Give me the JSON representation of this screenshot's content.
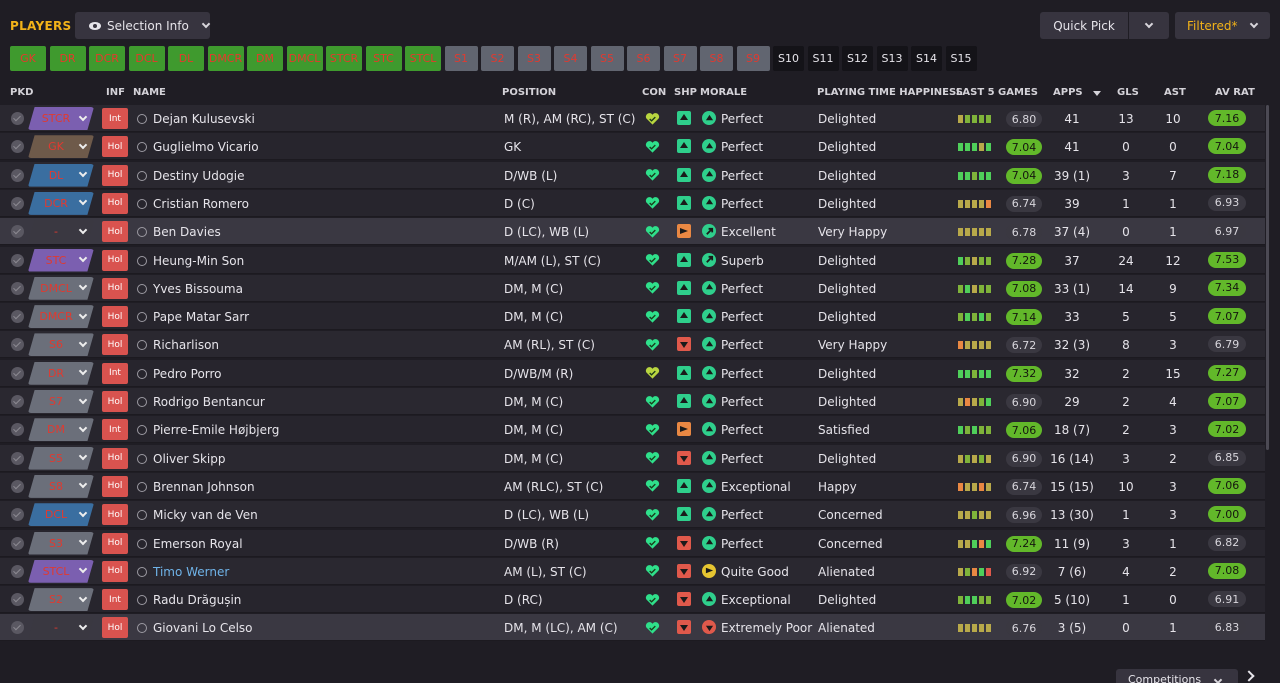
{
  "header": {
    "title": "PLAYERS",
    "selection_info": "Selection Info",
    "quick_pick": "Quick Pick",
    "filtered": "Filtered*"
  },
  "tags": [
    {
      "label": "GK",
      "style": "green"
    },
    {
      "label": "DR",
      "style": "green"
    },
    {
      "label": "DCR",
      "style": "green"
    },
    {
      "label": "DCL",
      "style": "green"
    },
    {
      "label": "DL",
      "style": "green"
    },
    {
      "label": "DMCR",
      "style": "green"
    },
    {
      "label": "DM",
      "style": "green"
    },
    {
      "label": "DMCL",
      "style": "green"
    },
    {
      "label": "STCR",
      "style": "green"
    },
    {
      "label": "STC",
      "style": "green"
    },
    {
      "label": "STCL",
      "style": "green"
    },
    {
      "label": "S1",
      "style": "grey"
    },
    {
      "label": "S2",
      "style": "grey"
    },
    {
      "label": "S3",
      "style": "grey"
    },
    {
      "label": "S4",
      "style": "grey"
    },
    {
      "label": "S5",
      "style": "grey"
    },
    {
      "label": "S6",
      "style": "grey"
    },
    {
      "label": "S7",
      "style": "grey"
    },
    {
      "label": "S8",
      "style": "grey"
    },
    {
      "label": "S9",
      "style": "grey"
    },
    {
      "label": "S10",
      "style": "dark"
    },
    {
      "label": "S11",
      "style": "dark"
    },
    {
      "label": "S12",
      "style": "dark"
    },
    {
      "label": "S13",
      "style": "dark"
    },
    {
      "label": "S14",
      "style": "dark"
    },
    {
      "label": "S15",
      "style": "dark"
    }
  ],
  "columns": {
    "pkd": "PKD",
    "inf": "INF",
    "name": "NAME",
    "position": "POSITION",
    "con": "CON",
    "shp": "SHP",
    "morale": "MORALE",
    "pth": "PLAYING TIME HAPPINESS",
    "last5": "LAST 5 GAMES",
    "apps": "APPS",
    "gls": "GLS",
    "ast": "AST",
    "avrat": "AV RAT"
  },
  "colors": {
    "accent": "#f3b319",
    "green_rating": "#62b82a",
    "status_up": "#2fcf8c",
    "status_down": "#e0594b",
    "status_mid": "#e98843",
    "position_text": "#e03a30"
  },
  "players": [
    {
      "pick": "STCR",
      "pick_color": "#7b5fb0",
      "inf": "Int",
      "name": "Dejan Kulusevski",
      "position": "M (R), AM (RC), ST (C)",
      "con": "good",
      "shp": "up",
      "morale": "Perfect",
      "morale_icon": "green-up",
      "pth": "Delighted",
      "last5": [
        "#b8a94a",
        "#7fb33a",
        "#7fb33a",
        "#7fb33a",
        "#7fb33a"
      ],
      "last5_avg": "6.80",
      "last5_style": "dk",
      "apps": "41",
      "gls": "13",
      "ast": "10",
      "avrat": "7.16",
      "avrat_style": "gr"
    },
    {
      "pick": "GK",
      "pick_color": "#6e5a4a",
      "inf": "Hol",
      "name": "Guglielmo Vicario",
      "position": "GK",
      "con": "full",
      "shp": "up",
      "morale": "Perfect",
      "morale_icon": "green-up",
      "pth": "Delighted",
      "last5": [
        "#4fcf5a",
        "#4fcf5a",
        "#4fcf5a",
        "#b8a94a",
        "#4fcf5a"
      ],
      "last5_avg": "7.04",
      "last5_style": "gr",
      "apps": "41",
      "gls": "0",
      "ast": "0",
      "avrat": "7.04",
      "avrat_style": "gr"
    },
    {
      "pick": "DL",
      "pick_color": "#3a6ea0",
      "inf": "Hol",
      "name": "Destiny Udogie",
      "position": "D/WB (L)",
      "con": "full",
      "shp": "up",
      "morale": "Perfect",
      "morale_icon": "green-up",
      "pth": "Delighted",
      "last5": [
        "#4fcf5a",
        "#4fcf5a",
        "#7fb33a",
        "#4fcf5a",
        "#4fcf5a"
      ],
      "last5_avg": "7.04",
      "last5_style": "gr",
      "apps": "39 (1)",
      "gls": "3",
      "ast": "7",
      "avrat": "7.18",
      "avrat_style": "gr"
    },
    {
      "pick": "DCR",
      "pick_color": "#3a6ea0",
      "inf": "Hol",
      "name": "Cristian Romero",
      "position": "D (C)",
      "con": "full",
      "shp": "up",
      "morale": "Perfect",
      "morale_icon": "green-up",
      "pth": "Delighted",
      "last5": [
        "#b8a94a",
        "#b8a94a",
        "#b8a94a",
        "#b8a94a",
        "#e98843"
      ],
      "last5_avg": "6.74",
      "last5_style": "dk",
      "apps": "39",
      "gls": "1",
      "ast": "1",
      "avrat": "6.93",
      "avrat_style": "dk"
    },
    {
      "pick": "-",
      "pick_color": "#3a3841",
      "inf": "Hol",
      "name": "Ben Davies",
      "position": "D (LC), WB (L)",
      "con": "full",
      "shp": "md",
      "morale": "Excellent",
      "morale_icon": "green-right",
      "pth": "Very Happy",
      "last5": [
        "#b8a94a",
        "#b8a94a",
        "#b8a94a",
        "#b8a94a",
        "#b8a94a"
      ],
      "last5_avg": "6.78",
      "last5_style": "dk",
      "apps": "37 (4)",
      "gls": "0",
      "ast": "1",
      "avrat": "6.97",
      "avrat_style": "dk"
    },
    {
      "pick": "STC",
      "pick_color": "#7b5fb0",
      "inf": "Hol",
      "name": "Heung-Min Son",
      "position": "M/AM (L), ST (C)",
      "con": "full",
      "shp": "up",
      "morale": "Superb",
      "morale_icon": "green-right",
      "pth": "Delighted",
      "last5": [
        "#4fcf5a",
        "#7fb33a",
        "#b8a94a",
        "#7fb33a",
        "#7fb33a"
      ],
      "last5_avg": "7.28",
      "last5_style": "gr",
      "apps": "37",
      "gls": "24",
      "ast": "12",
      "avrat": "7.53",
      "avrat_style": "gr"
    },
    {
      "pick": "DMCL",
      "pick_color": "#6b6f7a",
      "inf": "Hol",
      "name": "Yves Bissouma",
      "position": "DM, M (C)",
      "con": "full",
      "shp": "up",
      "morale": "Perfect",
      "morale_icon": "green-up",
      "pth": "Delighted",
      "last5": [
        "#7fb33a",
        "#4fcf5a",
        "#b8a94a",
        "#7fb33a",
        "#7fb33a"
      ],
      "last5_avg": "7.08",
      "last5_style": "gr",
      "apps": "33 (1)",
      "gls": "14",
      "ast": "9",
      "avrat": "7.34",
      "avrat_style": "gr"
    },
    {
      "pick": "DMCR",
      "pick_color": "#6b6f7a",
      "inf": "Hol",
      "name": "Pape Matar Sarr",
      "position": "DM, M (C)",
      "con": "full",
      "shp": "up",
      "morale": "Perfect",
      "morale_icon": "green-up",
      "pth": "Delighted",
      "last5": [
        "#7fb33a",
        "#4fcf5a",
        "#7fb33a",
        "#4fcf5a",
        "#7fb33a"
      ],
      "last5_avg": "7.14",
      "last5_style": "gr",
      "apps": "33",
      "gls": "5",
      "ast": "5",
      "avrat": "7.07",
      "avrat_style": "gr"
    },
    {
      "pick": "S6",
      "pick_color": "#6b6f7a",
      "inf": "Hol",
      "name": "Richarlison",
      "position": "AM (RL), ST (C)",
      "con": "full",
      "shp": "dn",
      "morale": "Perfect",
      "morale_icon": "green-up",
      "pth": "Very Happy",
      "last5": [
        "#e98843",
        "#b8a94a",
        "#b8a94a",
        "#b8a94a",
        "#b8a94a"
      ],
      "last5_avg": "6.72",
      "last5_style": "dk",
      "apps": "32 (3)",
      "gls": "8",
      "ast": "3",
      "avrat": "6.79",
      "avrat_style": "dk"
    },
    {
      "pick": "DR",
      "pick_color": "#6b6f7a",
      "inf": "Int",
      "name": "Pedro Porro",
      "position": "D/WB/M (R)",
      "con": "good",
      "shp": "up",
      "morale": "Perfect",
      "morale_icon": "green-up",
      "pth": "Delighted",
      "last5": [
        "#4fcf5a",
        "#4fcf5a",
        "#7fb33a",
        "#4fcf5a",
        "#4fcf5a"
      ],
      "last5_avg": "7.32",
      "last5_style": "gr",
      "apps": "32",
      "gls": "2",
      "ast": "15",
      "avrat": "7.27",
      "avrat_style": "gr"
    },
    {
      "pick": "S7",
      "pick_color": "#6b6f7a",
      "inf": "Hol",
      "name": "Rodrigo Bentancur",
      "position": "DM, M (C)",
      "con": "full",
      "shp": "up",
      "morale": "Perfect",
      "morale_icon": "green-up",
      "pth": "Delighted",
      "last5": [
        "#b8a94a",
        "#e98843",
        "#b8a94a",
        "#7fb33a",
        "#4fcf5a"
      ],
      "last5_avg": "6.90",
      "last5_style": "dk",
      "apps": "29",
      "gls": "2",
      "ast": "4",
      "avrat": "7.07",
      "avrat_style": "gr"
    },
    {
      "pick": "DM",
      "pick_color": "#6b6f7a",
      "inf": "Int",
      "name": "Pierre-Emile Højbjerg",
      "position": "DM, M (C)",
      "con": "full",
      "shp": "md",
      "morale": "Perfect",
      "morale_icon": "green-up",
      "pth": "Satisfied",
      "last5": [
        "#4fcf5a",
        "#7fb33a",
        "#4fcf5a",
        "#7fb33a",
        "#7fb33a"
      ],
      "last5_avg": "7.06",
      "last5_style": "gr",
      "apps": "18 (7)",
      "gls": "2",
      "ast": "3",
      "avrat": "7.02",
      "avrat_style": "gr"
    },
    {
      "pick": "S5",
      "pick_color": "#6b6f7a",
      "inf": "Hol",
      "name": "Oliver Skipp",
      "position": "DM, M (C)",
      "con": "full",
      "shp": "dn",
      "morale": "Perfect",
      "morale_icon": "green-up",
      "pth": "Delighted",
      "last5": [
        "#b8a94a",
        "#7fb33a",
        "#b8a94a",
        "#7fb33a",
        "#b8a94a"
      ],
      "last5_avg": "6.90",
      "last5_style": "dk",
      "apps": "16 (14)",
      "gls": "3",
      "ast": "2",
      "avrat": "6.85",
      "avrat_style": "dk"
    },
    {
      "pick": "S8",
      "pick_color": "#6b6f7a",
      "inf": "Hol",
      "name": "Brennan Johnson",
      "position": "AM (RLC), ST (C)",
      "con": "full",
      "shp": "up",
      "morale": "Exceptional",
      "morale_icon": "green-up",
      "pth": "Happy",
      "last5": [
        "#e98843",
        "#b8a94a",
        "#b8a94a",
        "#e98843",
        "#b8a94a"
      ],
      "last5_avg": "6.74",
      "last5_style": "dk",
      "apps": "15 (15)",
      "gls": "10",
      "ast": "3",
      "avrat": "7.06",
      "avrat_style": "gr"
    },
    {
      "pick": "DCL",
      "pick_color": "#3a6ea0",
      "inf": "Hol",
      "name": "Micky van de Ven",
      "position": "D (LC), WB (L)",
      "con": "full",
      "shp": "up",
      "morale": "Perfect",
      "morale_icon": "green-up",
      "pth": "Concerned",
      "last5": [
        "#b8a94a",
        "#b8a94a",
        "#7fb33a",
        "#b8a94a",
        "#b8a94a"
      ],
      "last5_avg": "6.96",
      "last5_style": "dk",
      "apps": "13 (30)",
      "gls": "1",
      "ast": "3",
      "avrat": "7.00",
      "avrat_style": "gr"
    },
    {
      "pick": "S3",
      "pick_color": "#6b6f7a",
      "inf": "Hol",
      "name": "Emerson Royal",
      "position": "D/WB (R)",
      "con": "full",
      "shp": "dn",
      "morale": "Perfect",
      "morale_icon": "green-up",
      "pth": "Concerned",
      "last5": [
        "#b8a94a",
        "#b8a94a",
        "#4fcf5a",
        "#e98843",
        "#4fcf5a"
      ],
      "last5_avg": "7.24",
      "last5_style": "gr",
      "apps": "11 (9)",
      "gls": "3",
      "ast": "1",
      "avrat": "6.82",
      "avrat_style": "dk"
    },
    {
      "pick": "STCL",
      "pick_color": "#7b5fb0",
      "inf": "Hol",
      "name": "Timo Werner",
      "position": "AM (L), ST (C)",
      "con": "full",
      "shp": "dn",
      "morale": "Quite Good",
      "morale_icon": "yellow-right",
      "pth": "Alienated",
      "last5": [
        "#b8a94a",
        "#7fb33a",
        "#e98843",
        "#4fcf5a",
        "#e0594b"
      ],
      "last5_avg": "6.92",
      "last5_style": "dk",
      "apps": "7 (6)",
      "gls": "4",
      "ast": "2",
      "avrat": "7.08",
      "avrat_style": "gr",
      "link": true
    },
    {
      "pick": "S2",
      "pick_color": "#6b6f7a",
      "inf": "Int",
      "name": "Radu Drăgușin",
      "position": "D (RC)",
      "con": "full",
      "shp": "dn",
      "morale": "Exceptional",
      "morale_icon": "green-up",
      "pth": "Delighted",
      "last5": [
        "#7fb33a",
        "#4fcf5a",
        "#4fcf5a",
        "#7fb33a",
        "#7fb33a"
      ],
      "last5_avg": "7.02",
      "last5_style": "gr",
      "apps": "5 (10)",
      "gls": "1",
      "ast": "0",
      "avrat": "6.91",
      "avrat_style": "dk"
    },
    {
      "pick": "-",
      "pick_color": "#3a3841",
      "inf": "Hol",
      "name": "Giovani Lo Celso",
      "position": "DM, M (LC), AM (C)",
      "con": "full",
      "shp": "dn",
      "morale": "Extremely Poor",
      "morale_icon": "red-down",
      "pth": "Alienated",
      "last5": [
        "#b8a94a",
        "#b8a94a",
        "#b8a94a",
        "#b8a94a",
        "#b8a94a"
      ],
      "last5_avg": "6.76",
      "last5_style": "dk",
      "apps": "3 (5)",
      "gls": "0",
      "ast": "1",
      "avrat": "6.83",
      "avrat_style": "dk"
    }
  ],
  "footer": {
    "competitions": "Competitions"
  }
}
